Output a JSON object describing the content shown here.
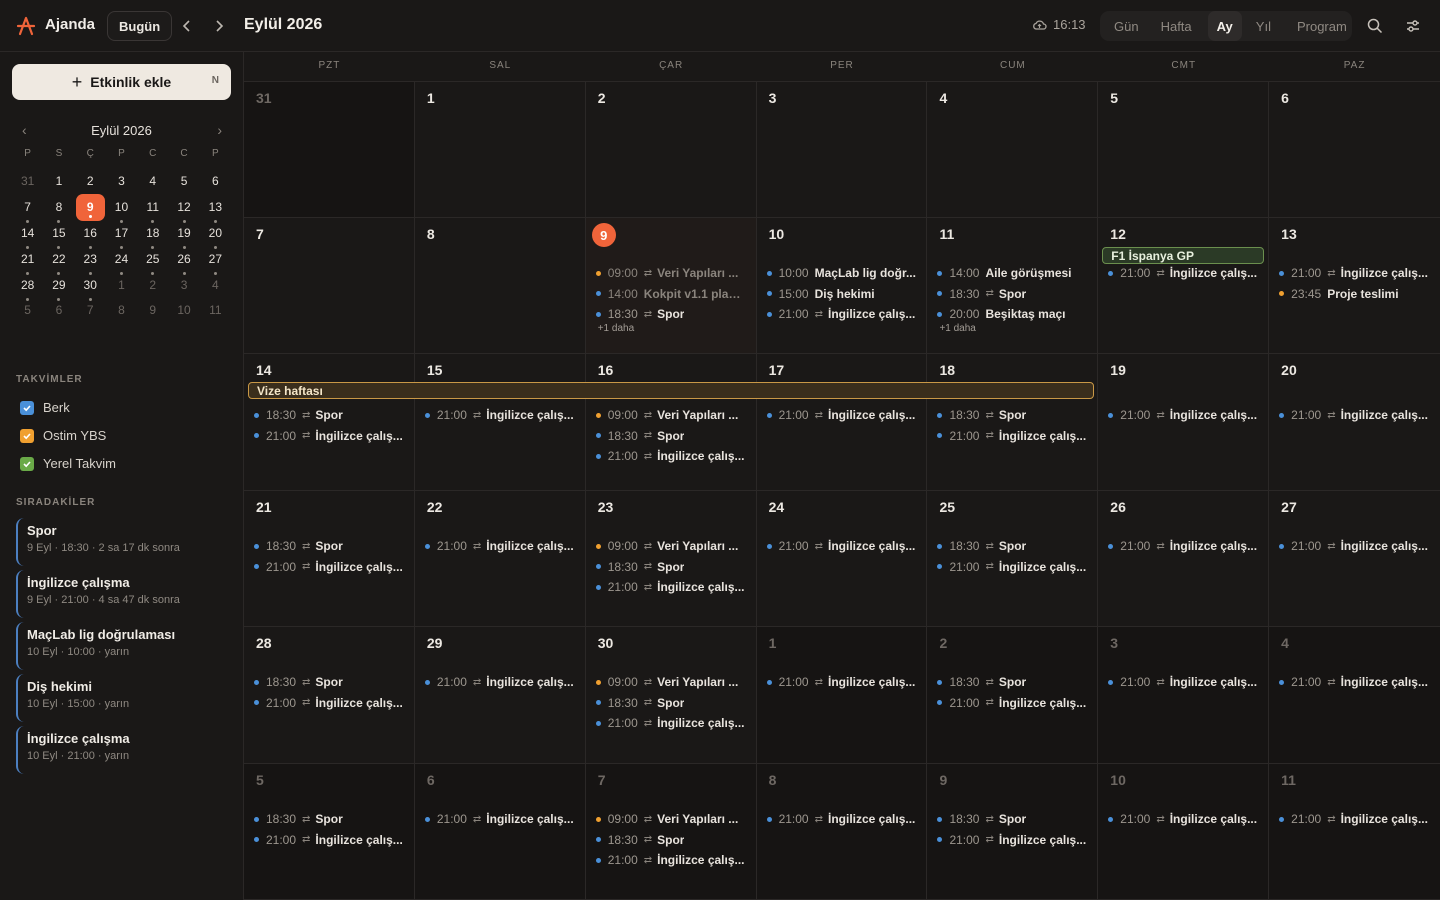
{
  "app": {
    "name": "Ajanda"
  },
  "header": {
    "today_label": "Bugün",
    "title": "Eylül 2026",
    "sync_time": "16:13",
    "views": [
      "Gün",
      "Hafta",
      "Ay",
      "Yıl",
      "Program"
    ],
    "active_view": "Ay"
  },
  "sidebar": {
    "add_event_label": "Etkinlik ekle",
    "add_event_shortcut": "N",
    "mini_calendar": {
      "title": "Eylül 2026",
      "dow": [
        "P",
        "S",
        "Ç",
        "P",
        "C",
        "C",
        "P"
      ],
      "weeks": [
        [
          "31",
          "1",
          "2",
          "3",
          "4",
          "5",
          "6"
        ],
        [
          "7",
          "8",
          "9",
          "10",
          "11",
          "12",
          "13"
        ],
        [
          "14",
          "15",
          "16",
          "17",
          "18",
          "19",
          "20"
        ],
        [
          "21",
          "22",
          "23",
          "24",
          "25",
          "26",
          "27"
        ],
        [
          "28",
          "29",
          "30",
          "1",
          "2",
          "3",
          "4"
        ],
        [
          "5",
          "6",
          "7",
          "8",
          "9",
          "10",
          "11"
        ]
      ]
    },
    "calendars_label": "TAKVİMLER",
    "calendars": [
      {
        "name": "Berk",
        "color": "#4a90d9"
      },
      {
        "name": "Ostim YBS",
        "color": "#f0a030"
      },
      {
        "name": "Yerel Takvim",
        "color": "#6aaa48"
      }
    ],
    "upnext_label": "SIRADAKİLER",
    "upnext": [
      {
        "title": "Spor",
        "meta": "9 Eyl · 18:30 · 2 sa 17 dk sonra"
      },
      {
        "title": "İngilizce çalışma",
        "meta": "9 Eyl · 21:00 · 4 sa 47 dk sonra"
      },
      {
        "title": "MaçLab lig doğrulaması",
        "meta": "10 Eyl · 10:00 · yarın"
      },
      {
        "title": "Diş hekimi",
        "meta": "10 Eyl · 15:00 · yarın"
      },
      {
        "title": "İngilizce çalışma",
        "meta": "10 Eyl · 21:00 · yarın"
      }
    ]
  },
  "month": {
    "dow": [
      "PZT",
      "SAL",
      "ÇAR",
      "PER",
      "CUM",
      "CMT",
      "PAZ"
    ],
    "span_event": "Vize haftası",
    "weeks": [
      [
        {
          "n": "31",
          "out": true,
          "ev": []
        },
        {
          "n": "1",
          "ev": []
        },
        {
          "n": "2",
          "ev": []
        },
        {
          "n": "3",
          "ev": []
        },
        {
          "n": "4",
          "ev": []
        },
        {
          "n": "5",
          "ev": []
        },
        {
          "n": "6",
          "ev": []
        }
      ],
      [
        {
          "n": "7",
          "ev": []
        },
        {
          "n": "8",
          "ev": []
        },
        {
          "n": "9",
          "today": true,
          "ev": [
            {
              "c": "o",
              "t": "09:00",
              "r": true,
              "ti": "Veri Yapıları ...",
              "past": true
            },
            {
              "c": "b",
              "t": "14:00",
              "r": false,
              "ti": "Kokpit v1.1 planl...",
              "past": true
            },
            {
              "c": "b",
              "t": "18:30",
              "r": true,
              "ti": "Spor"
            }
          ],
          "more": "+1 daha"
        },
        {
          "n": "10",
          "ev": [
            {
              "c": "b",
              "t": "10:00",
              "r": false,
              "ti": "MaçLab lig doğr..."
            },
            {
              "c": "b",
              "t": "15:00",
              "r": false,
              "ti": "Diş hekimi"
            },
            {
              "c": "b",
              "t": "21:00",
              "r": true,
              "ti": "İngilizce çalış..."
            }
          ]
        },
        {
          "n": "11",
          "ev": [
            {
              "c": "b",
              "t": "14:00",
              "r": false,
              "ti": "Aile görüşmesi"
            },
            {
              "c": "b",
              "t": "18:30",
              "r": true,
              "ti": "Spor"
            },
            {
              "c": "b",
              "t": "20:00",
              "r": false,
              "ti": "Beşiktaş maçı"
            }
          ],
          "more": "+1 daha"
        },
        {
          "n": "12",
          "allday": "F1 İspanya GP",
          "ev": [
            {
              "c": "b",
              "t": "21:00",
              "r": true,
              "ti": "İngilizce çalış..."
            }
          ]
        },
        {
          "n": "13",
          "ev": [
            {
              "c": "b",
              "t": "21:00",
              "r": true,
              "ti": "İngilizce çalış..."
            },
            {
              "c": "o",
              "t": "23:45",
              "r": false,
              "ti": "Proje teslimi"
            }
          ]
        }
      ],
      [
        {
          "n": "14",
          "ev": [
            {
              "c": "b",
              "t": "18:30",
              "r": true,
              "ti": "Spor"
            },
            {
              "c": "b",
              "t": "21:00",
              "r": true,
              "ti": "İngilizce çalış..."
            }
          ]
        },
        {
          "n": "15",
          "ev": [
            {
              "c": "b",
              "t": "21:00",
              "r": true,
              "ti": "İngilizce çalış..."
            }
          ]
        },
        {
          "n": "16",
          "ev": [
            {
              "c": "o",
              "t": "09:00",
              "r": true,
              "ti": "Veri Yapıları ..."
            },
            {
              "c": "b",
              "t": "18:30",
              "r": true,
              "ti": "Spor"
            },
            {
              "c": "b",
              "t": "21:00",
              "r": true,
              "ti": "İngilizce çalış..."
            }
          ]
        },
        {
          "n": "17",
          "ev": [
            {
              "c": "b",
              "t": "21:00",
              "r": true,
              "ti": "İngilizce çalış..."
            }
          ]
        },
        {
          "n": "18",
          "ev": [
            {
              "c": "b",
              "t": "18:30",
              "r": true,
              "ti": "Spor"
            },
            {
              "c": "b",
              "t": "21:00",
              "r": true,
              "ti": "İngilizce çalış..."
            }
          ]
        },
        {
          "n": "19",
          "ev": [
            {
              "c": "b",
              "t": "21:00",
              "r": true,
              "ti": "İngilizce çalış..."
            }
          ]
        },
        {
          "n": "20",
          "ev": [
            {
              "c": "b",
              "t": "21:00",
              "r": true,
              "ti": "İngilizce çalış..."
            }
          ]
        }
      ],
      [
        {
          "n": "21",
          "ev": [
            {
              "c": "b",
              "t": "18:30",
              "r": true,
              "ti": "Spor"
            },
            {
              "c": "b",
              "t": "21:00",
              "r": true,
              "ti": "İngilizce çalış..."
            }
          ]
        },
        {
          "n": "22",
          "ev": [
            {
              "c": "b",
              "t": "21:00",
              "r": true,
              "ti": "İngilizce çalış..."
            }
          ]
        },
        {
          "n": "23",
          "ev": [
            {
              "c": "o",
              "t": "09:00",
              "r": true,
              "ti": "Veri Yapıları ..."
            },
            {
              "c": "b",
              "t": "18:30",
              "r": true,
              "ti": "Spor"
            },
            {
              "c": "b",
              "t": "21:00",
              "r": true,
              "ti": "İngilizce çalış..."
            }
          ]
        },
        {
          "n": "24",
          "ev": [
            {
              "c": "b",
              "t": "21:00",
              "r": true,
              "ti": "İngilizce çalış..."
            }
          ]
        },
        {
          "n": "25",
          "ev": [
            {
              "c": "b",
              "t": "18:30",
              "r": true,
              "ti": "Spor"
            },
            {
              "c": "b",
              "t": "21:00",
              "r": true,
              "ti": "İngilizce çalış..."
            }
          ]
        },
        {
          "n": "26",
          "ev": [
            {
              "c": "b",
              "t": "21:00",
              "r": true,
              "ti": "İngilizce çalış..."
            }
          ]
        },
        {
          "n": "27",
          "ev": [
            {
              "c": "b",
              "t": "21:00",
              "r": true,
              "ti": "İngilizce çalış..."
            }
          ]
        }
      ],
      [
        {
          "n": "28",
          "ev": [
            {
              "c": "b",
              "t": "18:30",
              "r": true,
              "ti": "Spor"
            },
            {
              "c": "b",
              "t": "21:00",
              "r": true,
              "ti": "İngilizce çalış..."
            }
          ]
        },
        {
          "n": "29",
          "ev": [
            {
              "c": "b",
              "t": "21:00",
              "r": true,
              "ti": "İngilizce çalış..."
            }
          ]
        },
        {
          "n": "30",
          "ev": [
            {
              "c": "o",
              "t": "09:00",
              "r": true,
              "ti": "Veri Yapıları ..."
            },
            {
              "c": "b",
              "t": "18:30",
              "r": true,
              "ti": "Spor"
            },
            {
              "c": "b",
              "t": "21:00",
              "r": true,
              "ti": "İngilizce çalış..."
            }
          ]
        },
        {
          "n": "1",
          "out": true,
          "ev": [
            {
              "c": "b",
              "t": "21:00",
              "r": true,
              "ti": "İngilizce çalış..."
            }
          ]
        },
        {
          "n": "2",
          "out": true,
          "ev": [
            {
              "c": "b",
              "t": "18:30",
              "r": true,
              "ti": "Spor"
            },
            {
              "c": "b",
              "t": "21:00",
              "r": true,
              "ti": "İngilizce çalış..."
            }
          ]
        },
        {
          "n": "3",
          "out": true,
          "ev": [
            {
              "c": "b",
              "t": "21:00",
              "r": true,
              "ti": "İngilizce çalış..."
            }
          ]
        },
        {
          "n": "4",
          "out": true,
          "ev": [
            {
              "c": "b",
              "t": "21:00",
              "r": true,
              "ti": "İngilizce çalış..."
            }
          ]
        }
      ],
      [
        {
          "n": "5",
          "out": true,
          "ev": [
            {
              "c": "b",
              "t": "18:30",
              "r": true,
              "ti": "Spor"
            },
            {
              "c": "b",
              "t": "21:00",
              "r": true,
              "ti": "İngilizce çalış..."
            }
          ]
        },
        {
          "n": "6",
          "out": true,
          "ev": [
            {
              "c": "b",
              "t": "21:00",
              "r": true,
              "ti": "İngilizce çalış..."
            }
          ]
        },
        {
          "n": "7",
          "out": true,
          "ev": [
            {
              "c": "o",
              "t": "09:00",
              "r": true,
              "ti": "Veri Yapıları ..."
            },
            {
              "c": "b",
              "t": "18:30",
              "r": true,
              "ti": "Spor"
            },
            {
              "c": "b",
              "t": "21:00",
              "r": true,
              "ti": "İngilizce çalış..."
            }
          ]
        },
        {
          "n": "8",
          "out": true,
          "ev": [
            {
              "c": "b",
              "t": "21:00",
              "r": true,
              "ti": "İngilizce çalış..."
            }
          ]
        },
        {
          "n": "9",
          "out": true,
          "ev": [
            {
              "c": "b",
              "t": "18:30",
              "r": true,
              "ti": "Spor"
            },
            {
              "c": "b",
              "t": "21:00",
              "r": true,
              "ti": "İngilizce çalış..."
            }
          ]
        },
        {
          "n": "10",
          "out": true,
          "ev": [
            {
              "c": "b",
              "t": "21:00",
              "r": true,
              "ti": "İngilizce çalış..."
            }
          ]
        },
        {
          "n": "11",
          "out": true,
          "ev": [
            {
              "c": "b",
              "t": "21:00",
              "r": true,
              "ti": "İngilizce çalış..."
            }
          ]
        }
      ]
    ]
  },
  "colors": {
    "accent": "#f0643a",
    "event_blue": "#4a90d9",
    "event_orange": "#f0a030",
    "allday_green": "#6b8f4e",
    "span_gold": "#c99846"
  }
}
